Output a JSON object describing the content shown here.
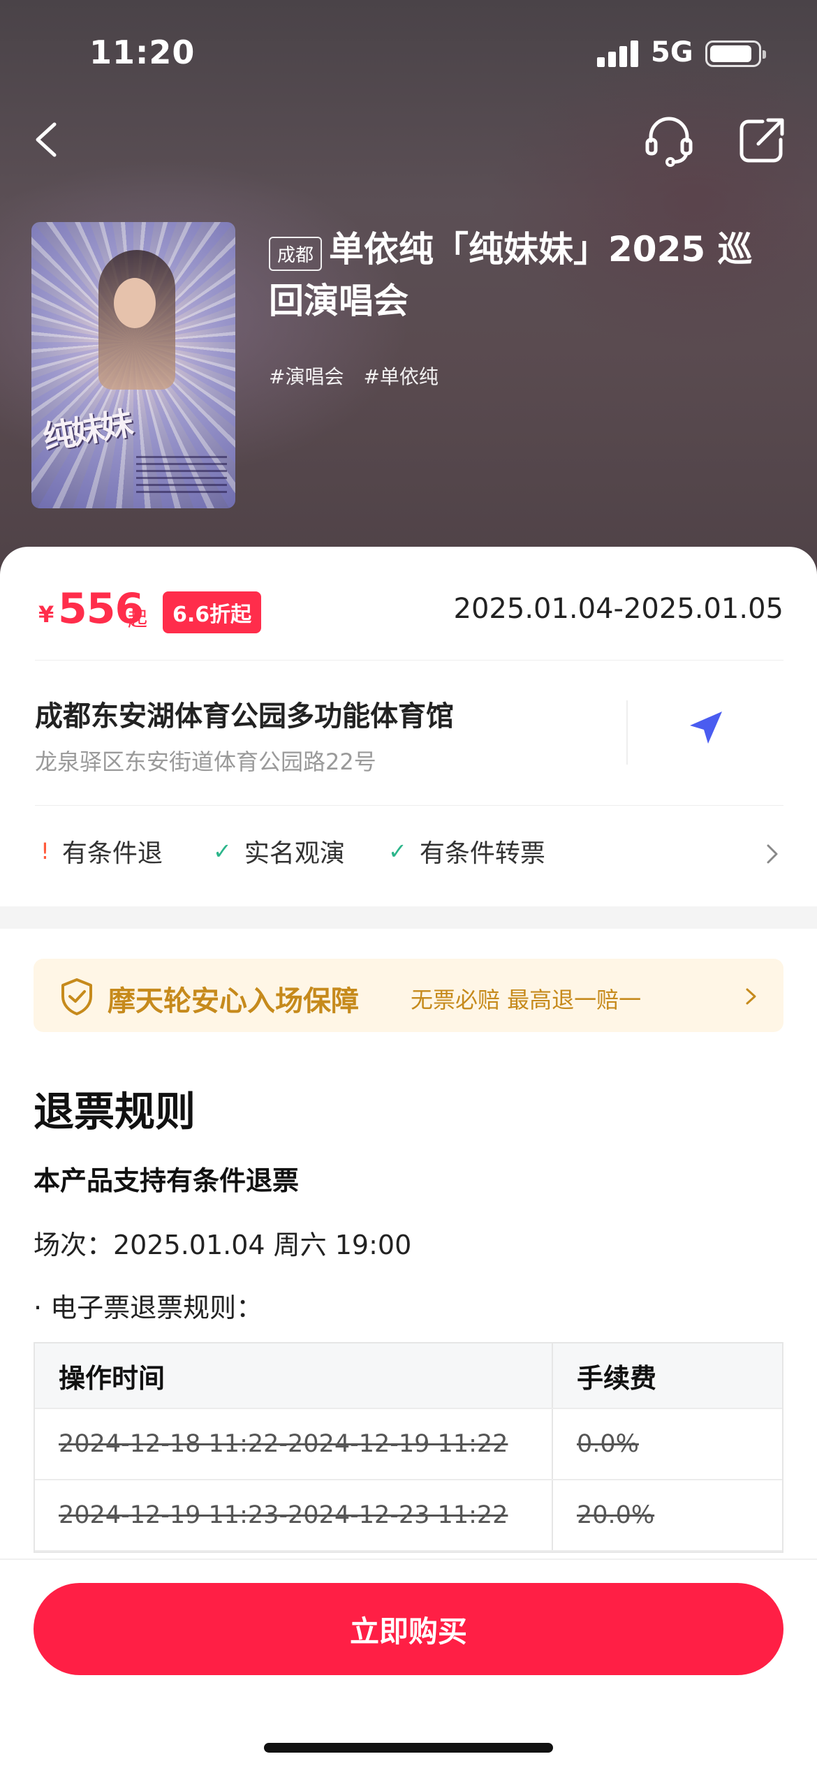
{
  "status_bar": {
    "time": "11:20",
    "network": "5G",
    "battery_level": 0.9
  },
  "header": {
    "city_tag": "成都",
    "title": "单依纯「纯妹妹」2025 巡回演唱会",
    "tags": [
      "#演唱会",
      "#单依纯"
    ],
    "icons": {
      "back": "back-chevron-icon",
      "service": "headset-icon",
      "share": "share-icon"
    }
  },
  "price": {
    "currency": "¥",
    "amount": "556",
    "suffix": "起",
    "discount": "6.6折起"
  },
  "date_range": "2025.01.04-2025.01.05",
  "venue": {
    "name": "成都东安湖体育公园多功能体育馆",
    "address": "龙泉驿区东安街道体育公园路22号"
  },
  "policies": [
    {
      "mark": "!",
      "label": "有条件退",
      "type": "warning"
    },
    {
      "mark": "✓",
      "label": "实名观演",
      "type": "ok"
    },
    {
      "mark": "✓",
      "label": "有条件转票",
      "type": "ok"
    }
  ],
  "guarantee": {
    "title": "摩天轮安心入场保障",
    "subtitle": "无票必赔 最高退一赔一"
  },
  "rules": {
    "heading": "退票规则",
    "support_text": "本产品支持有条件退票",
    "session": "场次：2025.01.04 周六 19:00",
    "e_ticket_rules": "· 电子票退票规则：",
    "table": {
      "headers": [
        "操作时间",
        "手续费"
      ],
      "rows": [
        [
          "2024-12-18 11:22-2024-12-19 11:22",
          "0.0%"
        ],
        [
          "2024-12-19 11:23-2024-12-23 11:22",
          "20.0%"
        ]
      ]
    }
  },
  "buy_button": "立即购买",
  "colors": {
    "accent": "#ff1f45",
    "price": "#ff2d4b",
    "guarantee_bg": "#fff6e6",
    "guarantee_text": "#c68a1c",
    "check": "#2bb58a",
    "warn": "#ff5a3c"
  }
}
